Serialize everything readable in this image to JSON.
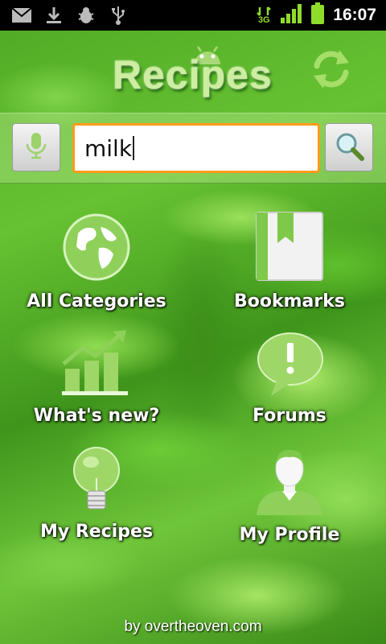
{
  "status_bar": {
    "time": "16:07",
    "network": "3G",
    "left_icons": [
      "gmail-icon",
      "download-icon",
      "debug-icon",
      "usb-icon"
    ],
    "right_icons": [
      "network-3g-icon",
      "signal-icon",
      "battery-icon"
    ]
  },
  "header": {
    "title": "Recipes"
  },
  "search": {
    "value": "milk"
  },
  "menu": [
    {
      "label": "All Categories",
      "icon": "globe-icon"
    },
    {
      "label": "Bookmarks",
      "icon": "bookmark-icon"
    },
    {
      "label": "What's new?",
      "icon": "chart-icon"
    },
    {
      "label": "Forums",
      "icon": "speech-bubble-icon"
    },
    {
      "label": "My Recipes",
      "icon": "lightbulb-icon"
    },
    {
      "label": "My Profile",
      "icon": "person-icon"
    }
  ],
  "footer": {
    "text": "by overtheoven.com"
  },
  "colors": {
    "accent_orange": "#ff9a1a",
    "title_green": "#cdeea0",
    "icon_green": "#8ed05a"
  }
}
